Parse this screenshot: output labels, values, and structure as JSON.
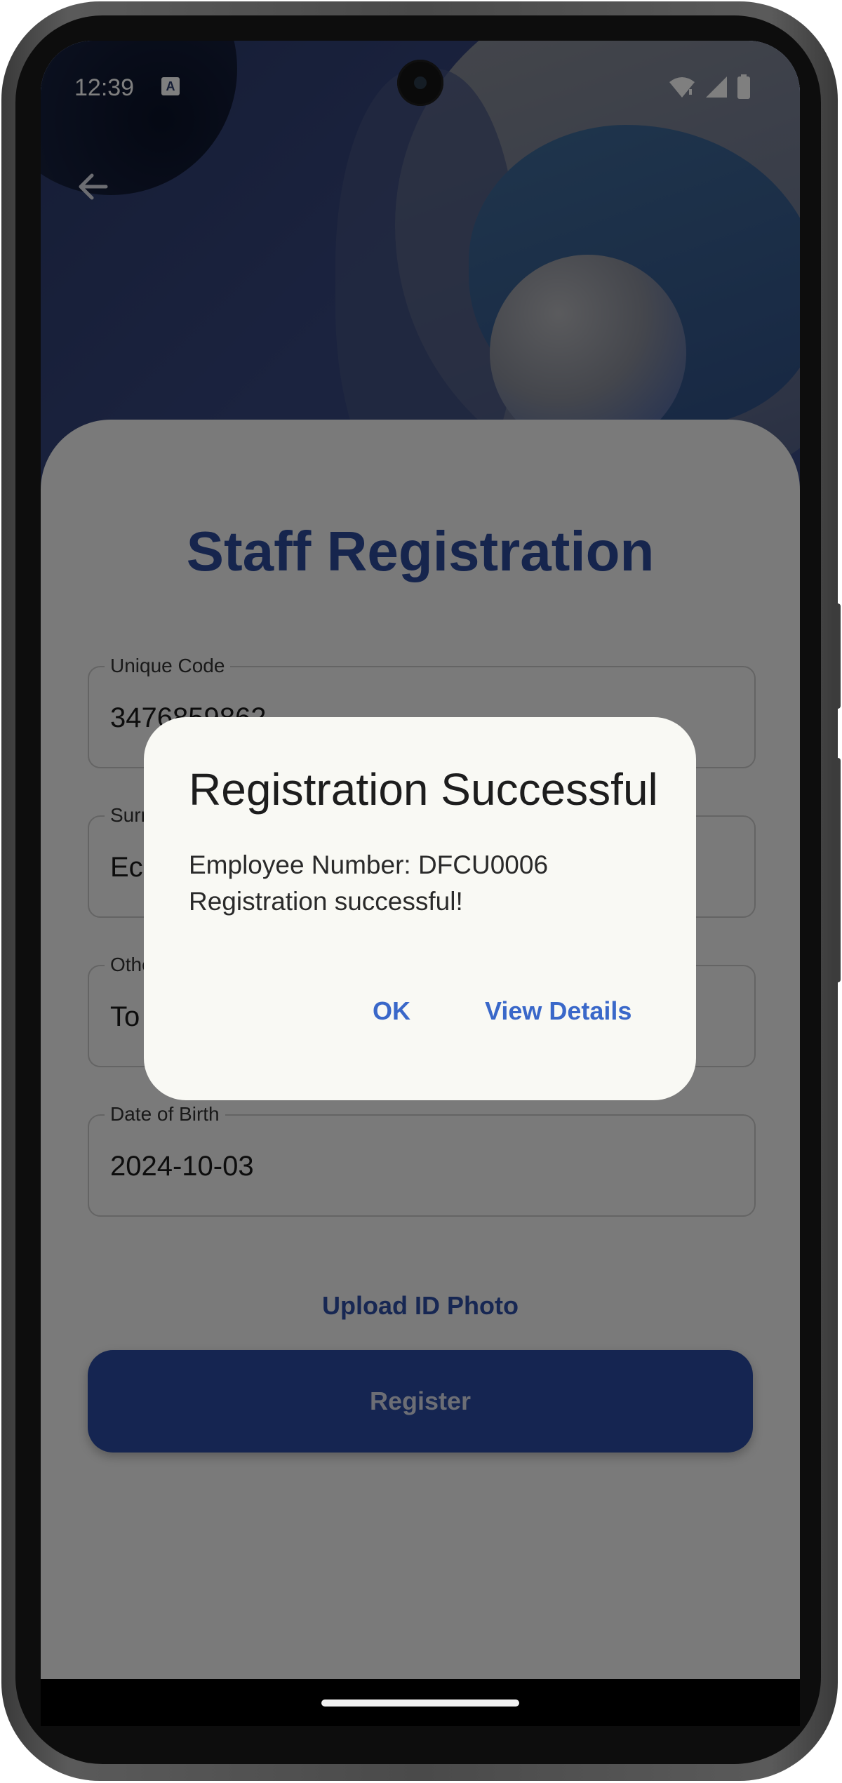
{
  "status_bar": {
    "time": "12:39",
    "notification_badge": "A"
  },
  "page": {
    "title": "Staff Registration",
    "upload_label": "Upload ID Photo",
    "register_label": "Register"
  },
  "form": {
    "fields": [
      {
        "label": "Unique Code",
        "value": "3476859862"
      },
      {
        "label": "Surname",
        "value": "Ec"
      },
      {
        "label": "Other Names",
        "value": "To"
      },
      {
        "label": "Date of Birth",
        "value": "2024-10-03"
      }
    ]
  },
  "dialog": {
    "title": "Registration Successful",
    "line1": "Employee Number: DFCU0006",
    "line2": "Registration successful!",
    "ok_label": "OK",
    "details_label": "View Details"
  },
  "colors": {
    "accent": "#2c4a9b",
    "dialog_button": "#3a68c9",
    "dialog_bg": "#f9f9f4"
  }
}
